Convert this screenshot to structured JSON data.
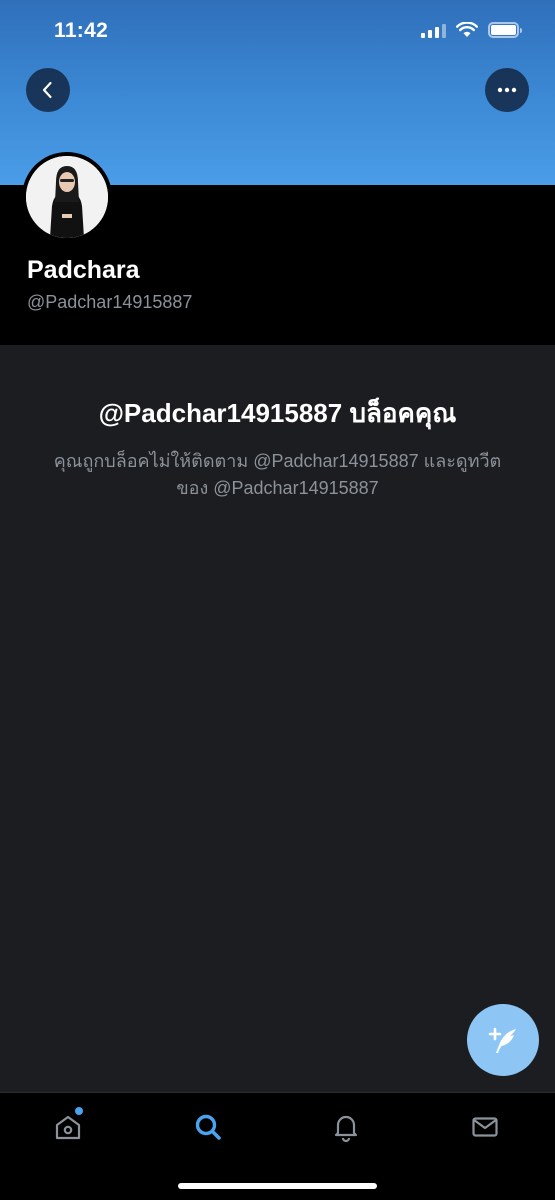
{
  "status_bar": {
    "time": "11:42",
    "battery_level": 1.0
  },
  "header": {
    "back_icon": "chevron-left-icon",
    "more_icon": "ellipsis-icon",
    "banner_color": "#4a9de8"
  },
  "profile": {
    "display_name": "Padchara",
    "handle": "@Padchar14915887"
  },
  "blocked_notice": {
    "title": "@Padchar14915887 บล็อคคุณ",
    "description": "คุณถูกบล็อคไม่ให้ติดตาม @Padchar14915887 และดูทวีตของ @Padchar14915887"
  },
  "fab": {
    "icon": "compose-tweet-icon",
    "color": "#8dc6f5"
  },
  "tab_bar": {
    "tabs": [
      {
        "icon": "home-icon",
        "has_badge": true
      },
      {
        "icon": "search-icon",
        "active": true
      },
      {
        "icon": "bell-icon"
      },
      {
        "icon": "mail-icon"
      }
    ],
    "active_color": "#4aa3ee"
  }
}
